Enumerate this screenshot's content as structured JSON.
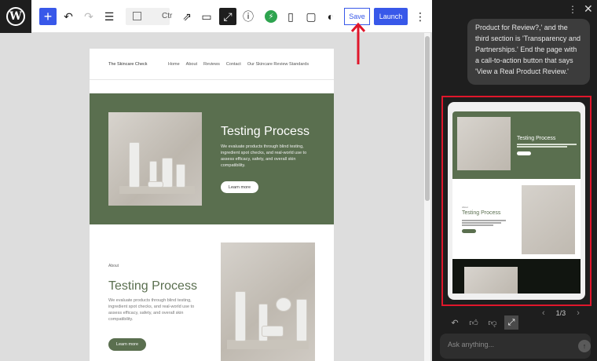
{
  "toolbar": {
    "add_label": "+",
    "doc_title": "Ctr",
    "save_label": "Save",
    "launch_label": "Launch"
  },
  "site": {
    "title": "The Skincare Check",
    "nav": [
      "Home",
      "About",
      "Reviews",
      "Contact",
      "Our Skincare Review Standards"
    ]
  },
  "hero": {
    "title": "Testing Process",
    "text": "We evaluate products through blind testing, ingredient spot checks, and real-world use to assess efficacy, safety, and overall skin compatibility.",
    "button": "Learn more"
  },
  "section2": {
    "kicker": "About",
    "title": "Testing Process",
    "text": "We evaluate products through blind testing, ingredient spot checks, and real-world use to assess efficacy, safety, and overall skin compatibility.",
    "button": "Learn more"
  },
  "chat": {
    "message": "Product for Review?,' and the third section is 'Transparency and Partnerships.' End the page with a call-to-action button that says 'View a Real Product Review.'",
    "pager": "1/3",
    "placeholder": "Ask anything..."
  },
  "preview": {
    "hero_title": "Testing Process",
    "section_kicker": "About",
    "section_title": "Testing Process"
  },
  "colors": {
    "accent": "#3858e9",
    "brand_green": "#5a6f4f",
    "highlight_red": "#e0162b"
  }
}
